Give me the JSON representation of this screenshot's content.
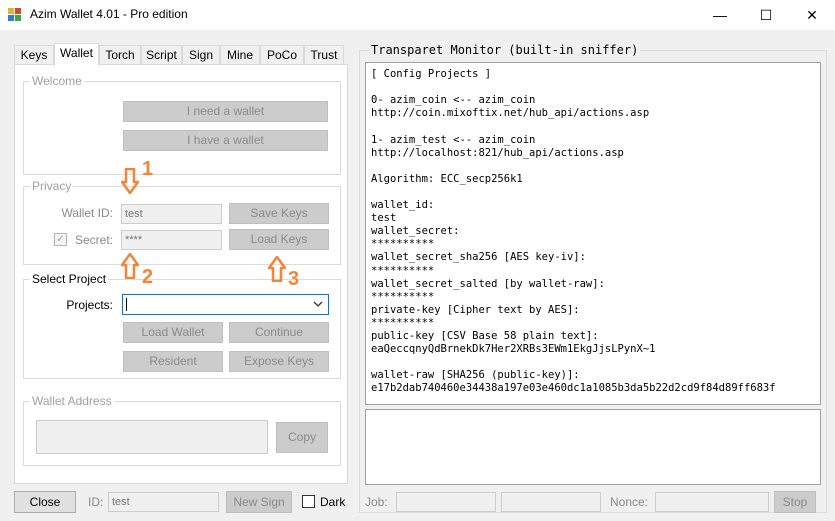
{
  "window": {
    "title": "Azim Wallet 4.01 - Pro edition",
    "controls": {
      "minimize": "—",
      "maximize": "☐",
      "close": "✕"
    }
  },
  "tabs": [
    {
      "label": "Keys",
      "active": false
    },
    {
      "label": "Wallet",
      "active": true
    },
    {
      "label": "Torch",
      "active": false
    },
    {
      "label": "Script",
      "active": false
    },
    {
      "label": "Sign",
      "active": false
    },
    {
      "label": "Mine",
      "active": false
    },
    {
      "label": "PoCo",
      "active": false
    },
    {
      "label": "Trust",
      "active": false
    }
  ],
  "welcome": {
    "legend": "Welcome",
    "need_wallet": "I need a wallet",
    "have_wallet": "I have a wallet"
  },
  "privacy": {
    "legend": "Privacy",
    "wallet_id_label": "Wallet ID:",
    "wallet_id_value": "test",
    "secret_label": "Secret:",
    "secret_value": "****",
    "secret_checked": true,
    "save_keys": "Save Keys",
    "load_keys": "Load Keys"
  },
  "select_project": {
    "legend": "Select Project",
    "projects_label": "Projects:",
    "projects_value": "",
    "load_wallet": "Load Wallet",
    "continue": "Continue",
    "resident": "Resident",
    "expose_keys": "Expose Keys"
  },
  "wallet_address": {
    "legend": "Wallet Address",
    "value": "",
    "copy": "Copy"
  },
  "annotations": {
    "a1": "1",
    "a2": "2",
    "a3": "3",
    "color": "#f4843a"
  },
  "monitor": {
    "title": "Transparet Monitor (built-in sniffer)",
    "lines": [
      "[ Config Projects ]",
      "",
      "0- azim_coin <-- azim_coin",
      "http://coin.mixoftix.net/hub_api/actions.asp",
      "",
      "1- azim_test <-- azim_coin",
      "http://localhost:821/hub_api/actions.asp",
      "",
      "Algorithm: ECC_secp256k1",
      "",
      "wallet_id:",
      "test",
      "wallet_secret:",
      "**********",
      "wallet_secret_sha256 [AES key-iv]:",
      "**********",
      "wallet_secret_salted [by wallet-raw]:",
      "**********",
      "private-key [Cipher text by AES]:",
      "**********",
      "public-key [CSV Base 58 plain text]:",
      "eaQeccqnyQdBrnekDk7Her2XRBs3EWm1EkgJjsLPynX~1",
      "",
      "wallet-raw [SHA256 (public-key)]:",
      "e17b2dab740460e34438a197e03e460dc1a1085b3da5b22d2cd9f84d89ff683f"
    ],
    "output": ""
  },
  "bottom": {
    "close": "Close",
    "id_label": "ID:",
    "id_value": "test",
    "new_sign": "New Sign",
    "dark_label": "Dark",
    "dark_checked": false,
    "job_label": "Job:",
    "job_value": "",
    "job_value2": "",
    "nonce_label": "Nonce:",
    "nonce_value": "",
    "stop": "Stop"
  }
}
